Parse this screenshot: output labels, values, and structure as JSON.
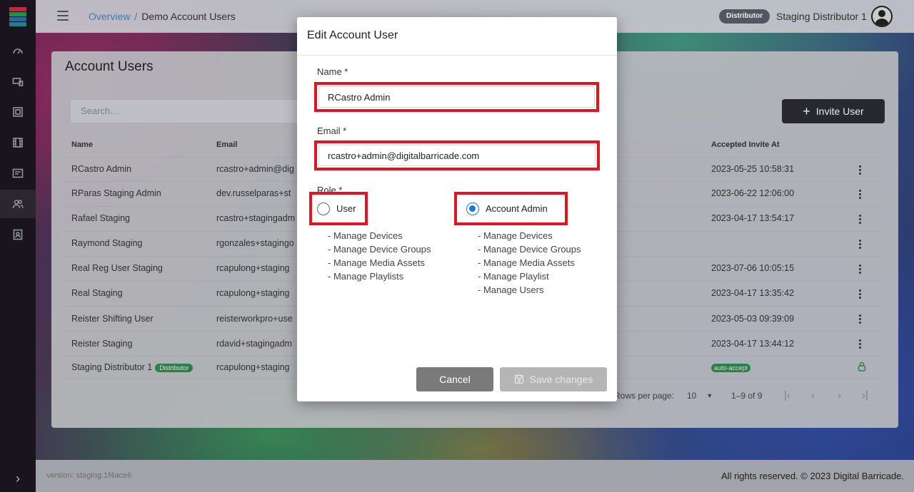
{
  "sidebar": {
    "logo_colors": [
      "#d32f3a",
      "#2e9a4e",
      "#2f6db8",
      "#1f8a9e"
    ],
    "icons": [
      "dashboard-icon",
      "devices-icon",
      "device-groups-icon",
      "media-icon",
      "playlists-icon",
      "users-icon",
      "account-icon"
    ],
    "active_icon": "users-icon"
  },
  "header": {
    "breadcrumb_link": "Overview",
    "breadcrumb_sep": "/",
    "breadcrumb_current": "Demo Account Users",
    "role_badge": "Distributor",
    "user_name": "Staging Distributor 1"
  },
  "page": {
    "title": "Account Users",
    "search_placeholder": "Search....",
    "invite_label": "Invite User",
    "columns": {
      "name": "Name",
      "email": "Email",
      "accepted": "Accepted Invite At"
    },
    "rows": [
      {
        "name": "RCastro Admin",
        "email": "rcastro+admin@dig",
        "accepted": "2023-05-25 10:58:31"
      },
      {
        "name": "RParas Staging Admin",
        "email": "dev.russelparas+st",
        "accepted": "2023-06-22 12:06:00"
      },
      {
        "name": "Rafael Staging",
        "email": "rcastro+stagingadm",
        "accepted": "2023-04-17 13:54:17"
      },
      {
        "name": "Raymond Staging",
        "email": "rgonzales+stagingo",
        "accepted": ""
      },
      {
        "name": "Real Reg User Staging",
        "email": "rcapulong+staging",
        "accepted": "2023-07-06 10:05:15"
      },
      {
        "name": "Real Staging",
        "email": "rcapulong+staging",
        "accepted": "2023-04-17 13:35:42"
      },
      {
        "name": "Reister Shifting User",
        "email": "reisterworkpro+use",
        "accepted": "2023-05-03 09:39:09"
      },
      {
        "name": "Reister Staging",
        "email": "rdavid+stagingadm",
        "accepted": "2023-04-17 13:44:12"
      }
    ],
    "last_row": {
      "name": "Staging Distributor 1",
      "tag": "Distributor",
      "email": "rcapulong+staging",
      "accepted_tag": "auto-accept"
    },
    "pagination": {
      "rows_label": "Rows per page:",
      "rows_value": "10",
      "range": "1–9 of 9"
    }
  },
  "footer": {
    "version": "version: staging.1f4ace6",
    "rights": "All rights reserved. © 2023 Digital Barricade."
  },
  "modal": {
    "title": "Edit Account User",
    "name_label": "Name *",
    "name_value": "RCastro Admin",
    "email_label": "Email *",
    "email_value": "rcastro+admin@digitalbarricade.com",
    "role_label": "Role *",
    "role_user": "User",
    "role_admin": "Account Admin",
    "selected_role": "Account Admin",
    "user_perms": [
      "- Manage Devices",
      "- Manage Device Groups",
      "- Manage Media Assets",
      "- Manage Playlists"
    ],
    "admin_perms": [
      "- Manage Devices",
      "- Manage Device Groups",
      "- Manage Media Assets",
      "- Manage Playlist",
      "- Manage Users"
    ],
    "cancel_label": "Cancel",
    "save_label": "Save changes",
    "highlight_color": "#e01521"
  }
}
